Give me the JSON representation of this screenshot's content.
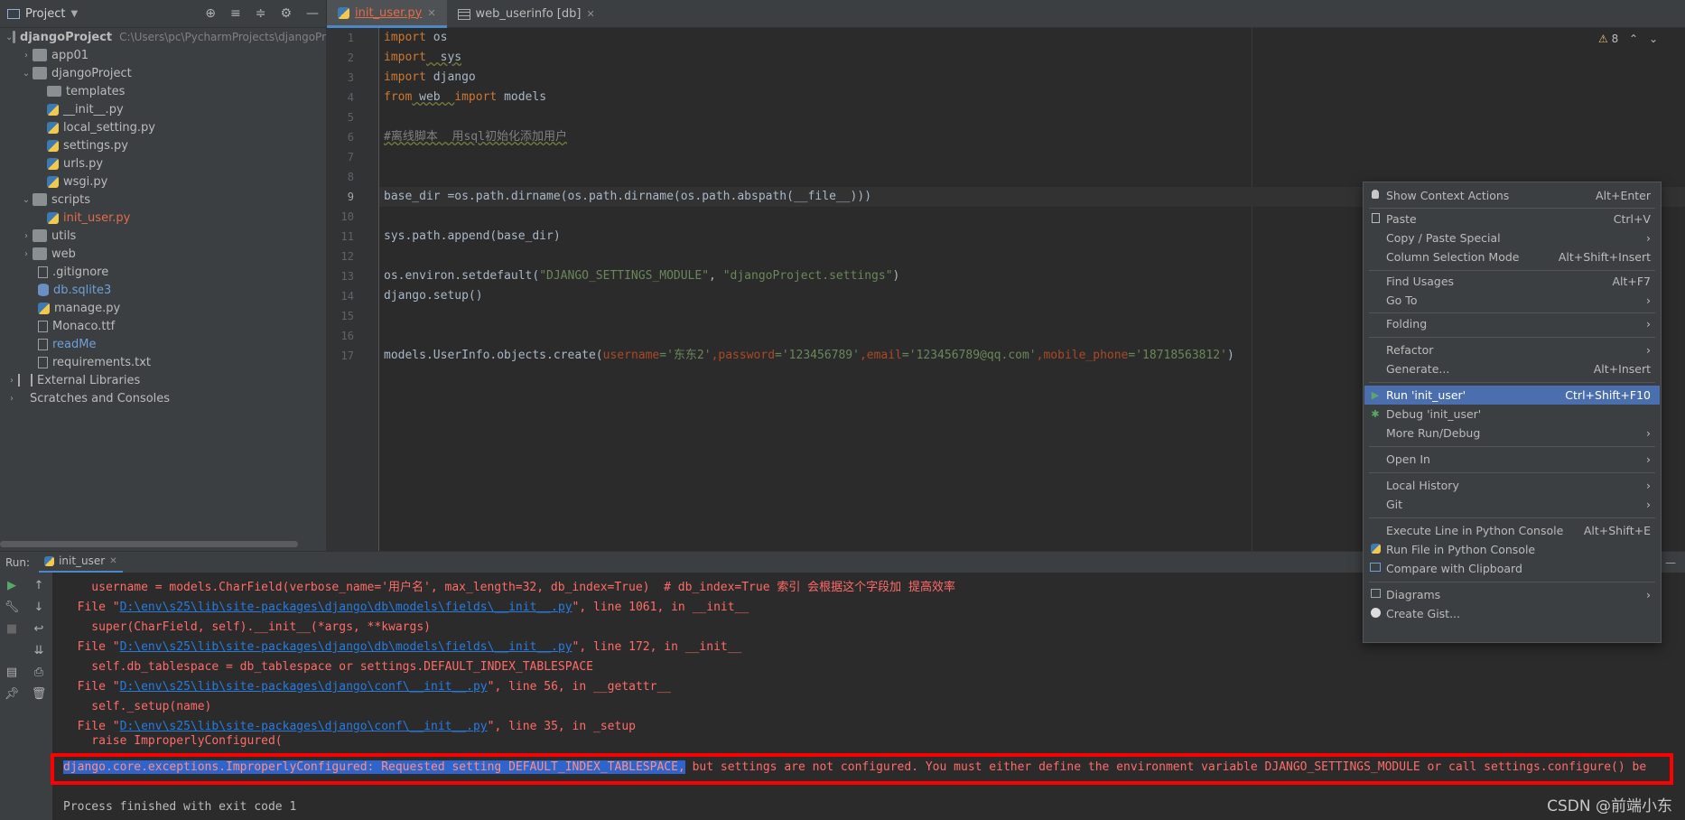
{
  "project": {
    "title": "Project",
    "dropdown_icon": "caret-down-icon",
    "tree": [
      {
        "label": "djangoProject",
        "path": "C:\\Users\\pc\\PycharmProjects\\djangoPr",
        "type": "folder",
        "expanded": true
      },
      {
        "label": "app01",
        "type": "folder",
        "expanded": false
      },
      {
        "label": "djangoProject",
        "type": "folder",
        "expanded": true
      },
      {
        "label": "templates",
        "type": "folder"
      },
      {
        "label": "__init__.py",
        "type": "py"
      },
      {
        "label": "local_setting.py",
        "type": "py"
      },
      {
        "label": "settings.py",
        "type": "py"
      },
      {
        "label": "urls.py",
        "type": "py"
      },
      {
        "label": "wsgi.py",
        "type": "py"
      },
      {
        "label": "scripts",
        "type": "folder",
        "expanded": true
      },
      {
        "label": "init_user.py",
        "type": "py"
      },
      {
        "label": "utils",
        "type": "folder",
        "expanded": false
      },
      {
        "label": "web",
        "type": "folder",
        "expanded": false
      },
      {
        "label": ".gitignore",
        "type": "txt"
      },
      {
        "label": "db.sqlite3",
        "type": "db"
      },
      {
        "label": "manage.py",
        "type": "py"
      },
      {
        "label": "Monaco.ttf",
        "type": "txt"
      },
      {
        "label": "readMe",
        "type": "txt"
      },
      {
        "label": "requirements.txt",
        "type": "txt"
      },
      {
        "label": "External Libraries",
        "type": "lib",
        "expanded": false
      },
      {
        "label": "Scratches and Consoles",
        "type": "scratch",
        "expanded": false
      }
    ]
  },
  "tabs": [
    {
      "label": "init_user.py",
      "active": true
    },
    {
      "label": "web_userinfo [db]",
      "active": false
    }
  ],
  "editor": {
    "warnings_count": "8",
    "line_numbers": [
      "1",
      "2",
      "3",
      "4",
      "5",
      "6",
      "7",
      "8",
      "9",
      "10",
      "11",
      "12",
      "13",
      "14",
      "15",
      "16",
      "17"
    ],
    "lines": {
      "l1_kw": "import",
      "l1_rest": " os",
      "l2_kw": "import",
      "l2_rest": "  sys",
      "l3_kw": "import",
      "l3_rest": " django",
      "l4_kw": "from",
      "l4_mid": " web  ",
      "l4_kw2": "import",
      "l4_rest": " models",
      "l6": "#离线脚本  用sql初始化添加用户",
      "l9": "base_dir =os.path.dirname(os.path.dirname(os.path.abspath(__file__)))",
      "l11": "sys.path.append(base_dir)",
      "l13_a": "os.environ.setdefault(",
      "l13_s1": "\"DJANGO_SETTINGS_MODULE\"",
      "l13_b": ", ",
      "l13_s2": "\"djangoProject.settings\"",
      "l13_c": ")",
      "l14": "django.setup()",
      "l17_a": "models.UserInfo.objects.create(",
      "l17_p1": "username",
      "l17_s1": "='东东2'",
      "l17_p2": ",password",
      "l17_s2": "='123456789'",
      "l17_p3": ",email",
      "l17_s3": "='123456789@qq.com'",
      "l17_p4": ",mobile_phone",
      "l17_s4": "='18718563812'",
      "l17_end": ")"
    }
  },
  "run": {
    "label": "Run:",
    "tab": "init_user",
    "console": {
      "c1": "    username = models.CharField(verbose_name='用户名', max_length=32, db_index=True)  # db_index=True 索引 会根据这个字段加 提高效率",
      "c2_a": "  File \"",
      "c2_link": "D:\\env\\s25\\lib\\site-packages\\django\\db\\models\\fields\\__init__.py",
      "c2_b": "\", line 1061, in __init__",
      "c3": "    super(CharField, self).__init__(*args, **kwargs)",
      "c4_a": "  File \"",
      "c4_link": "D:\\env\\s25\\lib\\site-packages\\django\\db\\models\\fields\\__init__.py",
      "c4_b": "\", line 172, in __init__",
      "c5": "    self.db_tablespace = db_tablespace or settings.DEFAULT_INDEX_TABLESPACE",
      "c6_a": "  File \"",
      "c6_link": "D:\\env\\s25\\lib\\site-packages\\django\\conf\\__init__.py",
      "c6_b": "\", line 56, in __getattr__",
      "c7": "    self._setup(name)",
      "c8_a": "  File \"",
      "c8_link": "D:\\env\\s25\\lib\\site-packages\\django\\conf\\__init__.py",
      "c8_b": "\", line 35, in _setup",
      "c9": "    raise ImproperlyConfigured(",
      "c10_hl": "django.core.exceptions.ImproperlyConfigured: Requested setting DEFAULT_INDEX_TABLESPACE,",
      "c10_rest": " but settings are not configured. You must either define the environment variable DJANGO_SETTINGS_MODULE or call settings.configure() be",
      "c11": "Process finished with exit code 1"
    }
  },
  "context_menu": {
    "items": [
      {
        "label": "Show Context Actions",
        "shortcut": "Alt+Enter",
        "icon": "bulb-icon"
      },
      {
        "label": "Paste",
        "shortcut": "Ctrl+V",
        "icon": "paste-icon"
      },
      {
        "label": "Copy / Paste Special",
        "submenu": true
      },
      {
        "label": "Column Selection Mode",
        "shortcut": "Alt+Shift+Insert"
      },
      {
        "label": "Find Usages",
        "shortcut": "Alt+F7"
      },
      {
        "label": "Go To",
        "submenu": true
      },
      {
        "label": "Folding",
        "submenu": true
      },
      {
        "label": "Refactor",
        "submenu": true
      },
      {
        "label": "Generate...",
        "shortcut": "Alt+Insert"
      },
      {
        "label": "Run 'init_user'",
        "shortcut": "Ctrl+Shift+F10",
        "icon": "run-icon",
        "selected": true
      },
      {
        "label": "Debug 'init_user'",
        "icon": "debug-icon"
      },
      {
        "label": "More Run/Debug",
        "submenu": true
      },
      {
        "label": "Open In",
        "submenu": true
      },
      {
        "label": "Local History",
        "submenu": true
      },
      {
        "label": "Git",
        "submenu": true
      },
      {
        "label": "Execute Line in Python Console",
        "shortcut": "Alt+Shift+E"
      },
      {
        "label": "Run File in Python Console",
        "icon": "python-icon"
      },
      {
        "label": "Compare with Clipboard",
        "icon": "compare-icon"
      },
      {
        "label": "Diagrams",
        "submenu": true,
        "icon": "diagram-icon"
      },
      {
        "label": "Create Gist...",
        "icon": "github-icon"
      }
    ],
    "submenu_glyph": "›"
  },
  "watermark": "CSDN @前端小东",
  "colors": {
    "selection": "#4b6eaf",
    "error_text": "#ff6b68",
    "highlight_box": "#ff0000"
  }
}
